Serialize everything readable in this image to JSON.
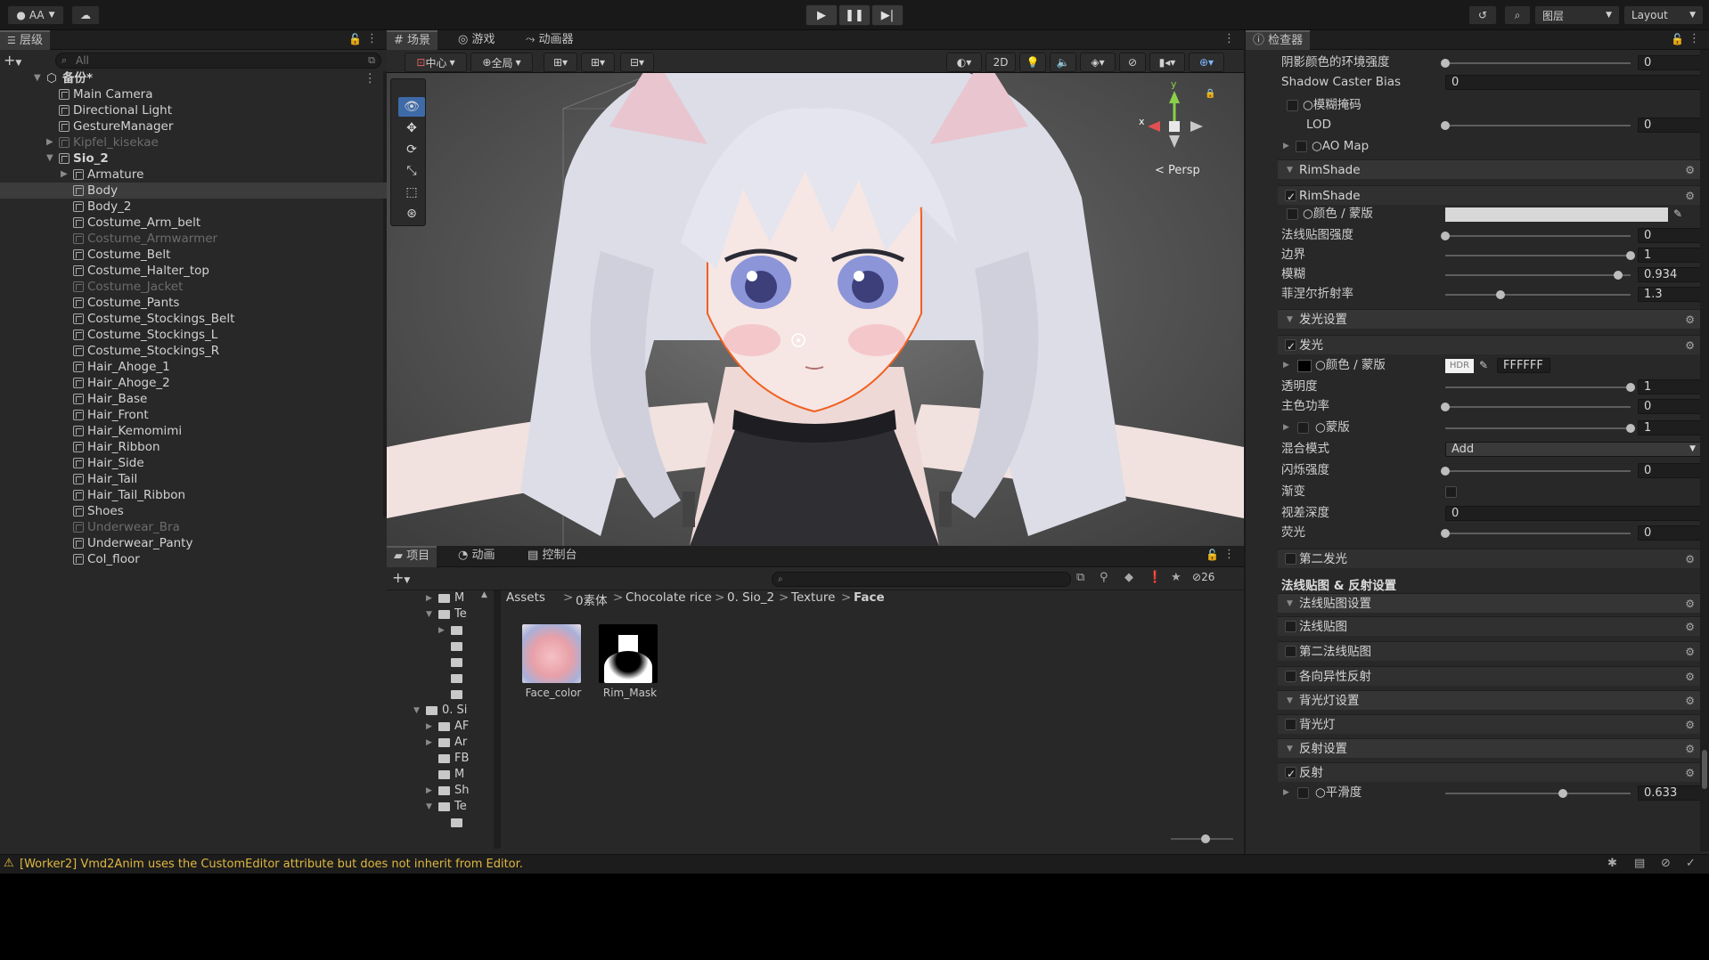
{
  "topbar": {
    "account": "AA",
    "layers": "图层",
    "layout": "Layout"
  },
  "hierarchy": {
    "tab": "层级",
    "search_placeholder": "All",
    "scene_name": "备份*",
    "items": [
      {
        "label": "Main Camera"
      },
      {
        "label": "Directional Light"
      },
      {
        "label": "GestureManager"
      },
      {
        "label": "Kipfel_kisekae"
      },
      {
        "label": "Sio_2"
      },
      {
        "label": "Armature"
      },
      {
        "label": "Body"
      },
      {
        "label": "Body_2"
      },
      {
        "label": "Costume_Arm_belt"
      },
      {
        "label": "Costume_Armwarmer"
      },
      {
        "label": "Costume_Belt"
      },
      {
        "label": "Costume_Halter_top"
      },
      {
        "label": "Costume_Jacket"
      },
      {
        "label": "Costume_Pants"
      },
      {
        "label": "Costume_Stockings_Belt"
      },
      {
        "label": "Costume_Stockings_L"
      },
      {
        "label": "Costume_Stockings_R"
      },
      {
        "label": "Hair_Ahoge_1"
      },
      {
        "label": "Hair_Ahoge_2"
      },
      {
        "label": "Hair_Base"
      },
      {
        "label": "Hair_Front"
      },
      {
        "label": "Hair_Kemomimi"
      },
      {
        "label": "Hair_Ribbon"
      },
      {
        "label": "Hair_Side"
      },
      {
        "label": "Hair_Tail"
      },
      {
        "label": "Hair_Tail_Ribbon"
      },
      {
        "label": "Shoes"
      },
      {
        "label": "Underwear_Bra"
      },
      {
        "label": "Underwear_Panty"
      },
      {
        "label": "Col_floor"
      }
    ]
  },
  "scene": {
    "tabs": [
      "场景",
      "游戏",
      "动画器"
    ],
    "pivot": "中心",
    "space": "全局",
    "mode2d": "2D",
    "persp": "Persp",
    "gizmo_x": "x",
    "gizmo_y": "y"
  },
  "project": {
    "tabs": [
      "项目",
      "动画",
      "控制台"
    ],
    "hidden_count": "26",
    "breadcrumb": [
      "Assets",
      "0素体",
      "Chocolate rice",
      "0. Sio_2",
      "Texture",
      "Face"
    ],
    "tree": [
      "M",
      "Te",
      "",
      "",
      "",
      "",
      "",
      "0. Si",
      "AF",
      "Ar",
      "FB",
      "M",
      "Sh",
      "Te",
      ""
    ],
    "assets": [
      {
        "label": "Face_color"
      },
      {
        "label": "Rim_Mask"
      }
    ]
  },
  "inspector": {
    "tab": "检查器",
    "rows": {
      "shadow_env": {
        "label": "阴影颜色的环境强度",
        "value": "0"
      },
      "shadow_bias": {
        "label": "Shadow Caster Bias",
        "value": "0"
      },
      "blur_mask": {
        "label": "模糊掩码"
      },
      "lod": {
        "label": "LOD",
        "value": "0"
      },
      "ao_map": {
        "label": "AO Map"
      },
      "rimshade_header": "RimShade",
      "rimshade_toggle": "RimShade",
      "rim_color": {
        "label": "颜色 / 蒙版"
      },
      "normal_strength": {
        "label": "法线贴图强度",
        "value": "0"
      },
      "border": {
        "label": "边界",
        "value": "1"
      },
      "blur": {
        "label": "模糊",
        "value": "0.934"
      },
      "fresnel": {
        "label": "菲涅尔折射率",
        "value": "1.3"
      },
      "emission_header": "发光设置",
      "emission_toggle": "发光",
      "emission_color": {
        "label": "颜色 / 蒙版",
        "hdr": "HDR",
        "hex": "FFFFFF"
      },
      "transparency": {
        "label": "透明度",
        "value": "1"
      },
      "main_power": {
        "label": "主色功率",
        "value": "0"
      },
      "mask": {
        "label": "蒙版",
        "value": "1"
      },
      "blend_mode": {
        "label": "混合模式",
        "value": "Add"
      },
      "blink": {
        "label": "闪烁强度",
        "value": "0"
      },
      "gradient": {
        "label": "渐变"
      },
      "parallax": {
        "label": "视差深度",
        "value": "0"
      },
      "fluorescence": {
        "label": "荧光",
        "value": "0"
      },
      "second_emission": "第二发光",
      "normal_section": "法线贴图 & 反射设置",
      "normal_settings": "法线贴图设置",
      "normal_map": "法线贴图",
      "second_normal": "第二法线贴图",
      "anisotropic": "各向异性反射",
      "backlight_settings": "背光灯设置",
      "backlight": "背光灯",
      "reflection_settings": "反射设置",
      "reflection": "反射",
      "smoothness": {
        "label": "平滑度",
        "value": "0.633"
      }
    },
    "sliders": {
      "shadow_env": 0,
      "lod": 0,
      "normal_strength": 0,
      "border": 1,
      "blur": 0.934,
      "fresnel": 0.3,
      "transparency": 1,
      "main_power": 0,
      "mask": 1,
      "blink": 0,
      "fluorescence": 0,
      "smoothness": 0.633
    }
  },
  "status": {
    "message": "[Worker2] Vmd2Anim uses the CustomEditor attribute but does not inherit from Editor."
  },
  "colors": {
    "accent": "#3a79d8",
    "warning": "#f0c040",
    "outline": "#f06020"
  }
}
